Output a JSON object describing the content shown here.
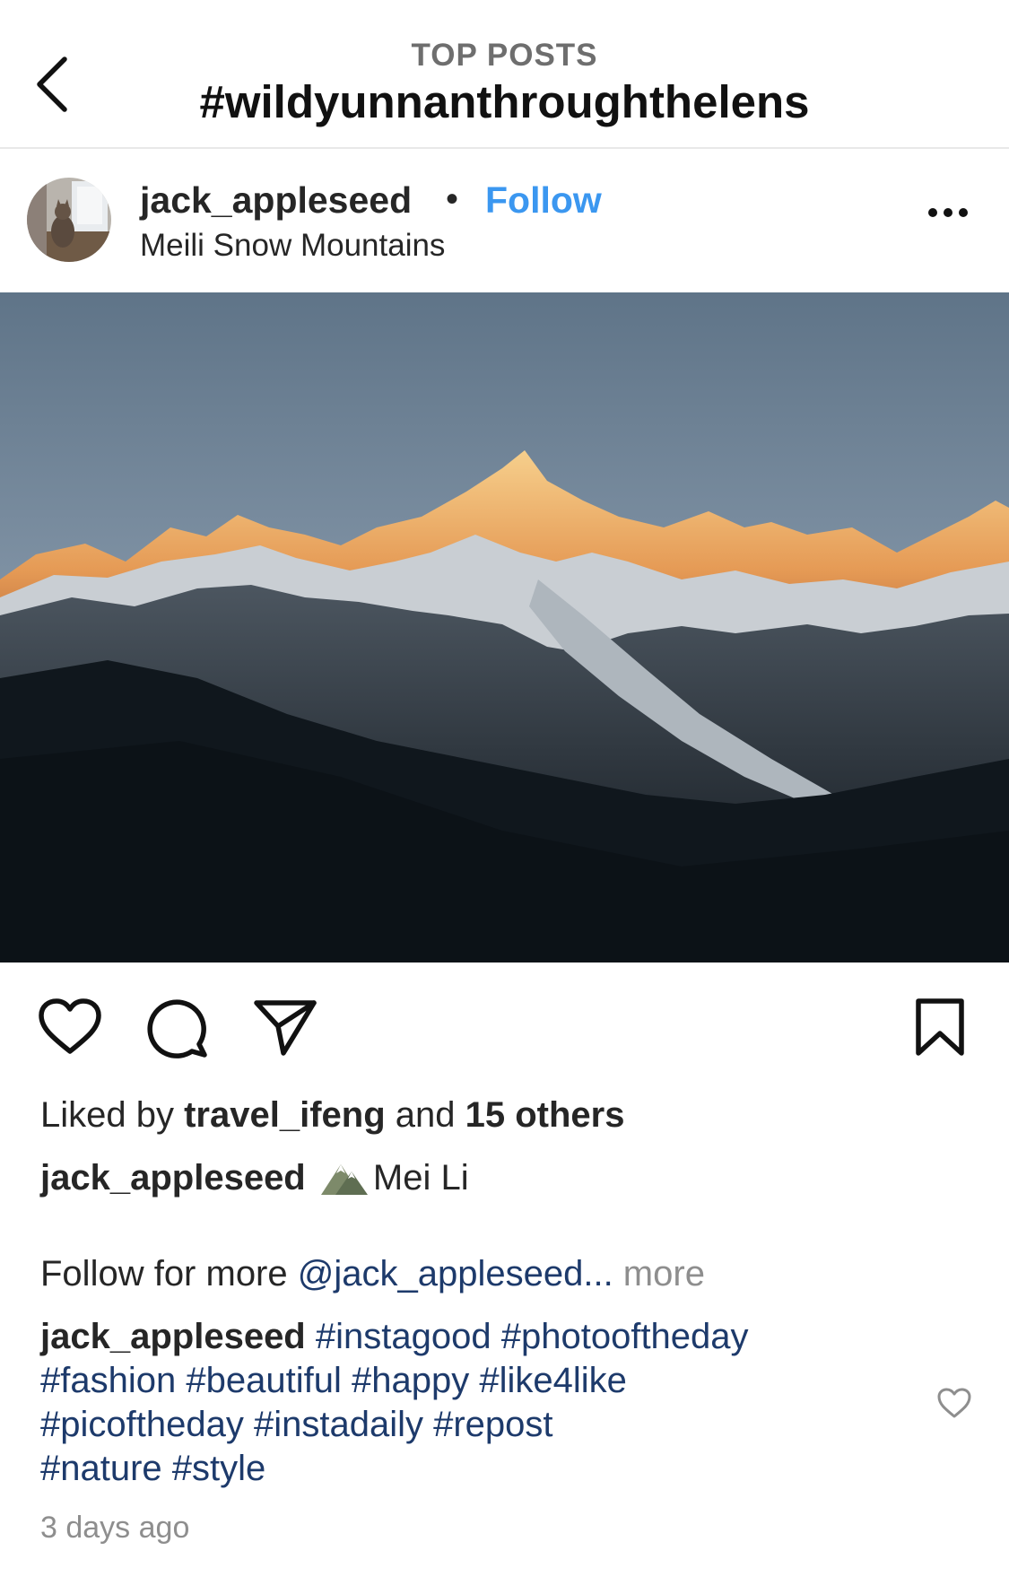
{
  "header": {
    "subtitle": "TOP POSTS",
    "title": "#wildyunnanthroughthelens"
  },
  "post": {
    "username": "jack_appleseed",
    "separator": "•",
    "follow_label": "Follow",
    "location": "Meili Snow Mountains",
    "image_subject": "Meili Snow Mountains at sunrise, golden peaks against blue-gray sky"
  },
  "likes": {
    "prefix": "Liked by ",
    "user": "travel_ifeng",
    "middle": " and ",
    "others": "15 others"
  },
  "caption": {
    "username": "jack_appleseed",
    "emoji": "mountain-emoji",
    "text": "Mei Li",
    "line2_prefix": "Follow for more ",
    "mention": "@jack_appleseed...",
    "more": " more"
  },
  "comment": {
    "username": "jack_appleseed",
    "hashtags": [
      "#instagood",
      "#photooftheday",
      "#fashion",
      "#beautiful",
      "#happy",
      "#like4like",
      "#picoftheday",
      "#instadaily",
      "#repost",
      "#nature",
      "#style"
    ]
  },
  "timestamp": "3 days ago",
  "colors": {
    "follow": "#3b97f0",
    "hashtag": "#1d3a6b",
    "muted": "#8e8e8e"
  }
}
